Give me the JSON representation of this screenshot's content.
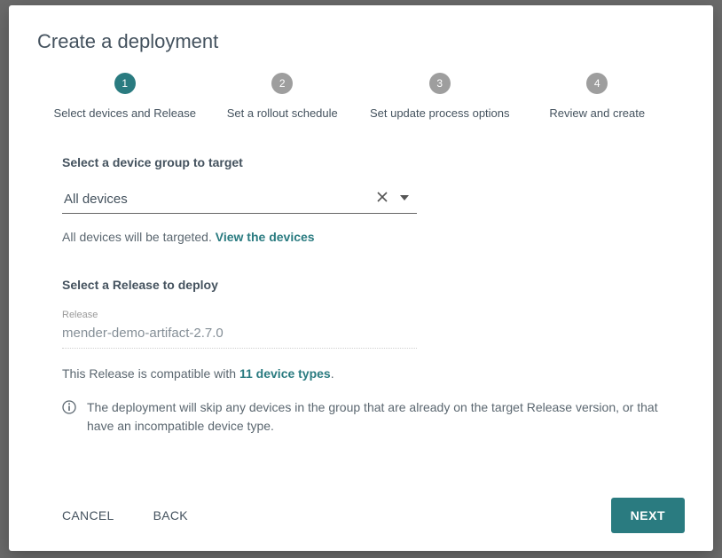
{
  "title": "Create a deployment",
  "steps": [
    {
      "num": "1",
      "label": "Select devices and Release",
      "active": true
    },
    {
      "num": "2",
      "label": "Set a rollout schedule",
      "active": false
    },
    {
      "num": "3",
      "label": "Set update process options",
      "active": false
    },
    {
      "num": "4",
      "label": "Review and create",
      "active": false
    }
  ],
  "group_section": {
    "heading": "Select a device group to target",
    "value": "All devices",
    "helper_text": "All devices will be targeted. ",
    "view_link": "View the devices"
  },
  "release_section": {
    "heading": "Select a Release to deploy",
    "field_label": "Release",
    "value": "mender-demo-artifact-2.7.0",
    "compat_prefix": "This Release is compatible with ",
    "compat_link": "11 device types",
    "compat_suffix": ".",
    "info_text": "The deployment will skip any devices in the group that are already on the target Release version, or that have an incompatible device type."
  },
  "footer": {
    "cancel": "CANCEL",
    "back": "BACK",
    "next": "NEXT"
  }
}
